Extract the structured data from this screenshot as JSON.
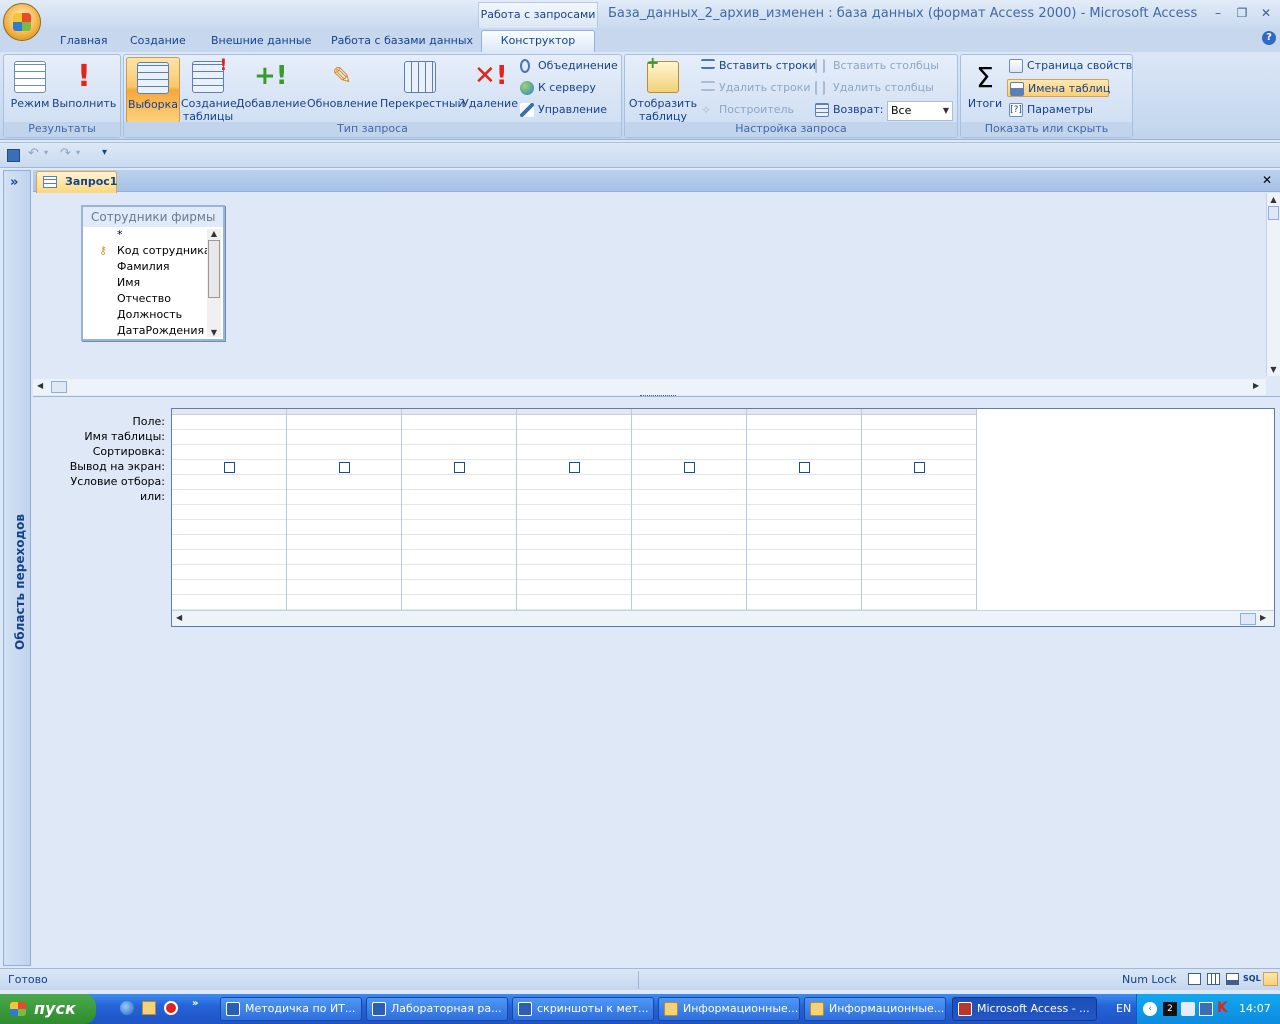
{
  "window": {
    "title": "База_данных_2_архив_изменен : база данных (формат Access 2000) - Microsoft Access",
    "context_group": "Работа с запросами",
    "minimize": "–",
    "restore": "❐",
    "close": "✕",
    "help": "?"
  },
  "tabs": [
    "Главная",
    "Создание",
    "Внешние данные",
    "Работа с базами данных",
    "Конструктор"
  ],
  "ribbon": {
    "results": {
      "label": "Результаты",
      "mode": "Режим",
      "run": "Выполнить"
    },
    "query_type": {
      "label": "Тип запроса",
      "select": "Выборка",
      "make_table_1": "Создание",
      "make_table_2": "таблицы",
      "append": "Добавление",
      "update": "Обновление",
      "crosstab": "Перекрестный",
      "delete": "Удаление",
      "union": "Объединение",
      "pass_through": "К серверу",
      "data_definition": "Управление"
    },
    "query_setup": {
      "label": "Настройка запроса",
      "show_table_1": "Отобразить",
      "show_table_2": "таблицу",
      "insert_rows": "Вставить строки",
      "delete_rows": "Удалить строки",
      "builder": "Построитель",
      "insert_columns": "Вставить столбцы",
      "delete_columns": "Удалить столбцы",
      "return_label": "Возврат:",
      "return_value": "Все"
    },
    "show_hide": {
      "label": "Показать или скрыть",
      "totals": "Итоги",
      "totals_symbol": "Σ",
      "property_sheet": "Страница свойств",
      "table_names": "Имена таблиц",
      "parameters": "Параметры"
    }
  },
  "nav_pane": {
    "title": "Область переходов",
    "toggle": "»"
  },
  "document": {
    "tab": "Запрос1",
    "close": "✕"
  },
  "table": {
    "title": "Сотрудники фирмы",
    "fields": [
      "*",
      "Код сотрудника",
      "Фамилия",
      "Имя",
      "Отчество",
      "Должность",
      "ДатаРождения"
    ]
  },
  "grid": {
    "row_labels": [
      "Поле:",
      "Имя таблицы:",
      "Сортировка:",
      "Вывод на экран:",
      "Условие отбора:",
      "или:"
    ],
    "column_count": 7
  },
  "status": {
    "text": "Готово",
    "numlock": "Num Lock",
    "sql": "SQL"
  },
  "taskbar": {
    "start": "пуск",
    "tasks": [
      "Методичка по ИТ...",
      "Лабораторная ра...",
      "скриншоты к мет...",
      "Информационные...",
      "Информационные...",
      "Microsoft Access - ..."
    ],
    "lang": "EN",
    "clock": "14:07"
  }
}
